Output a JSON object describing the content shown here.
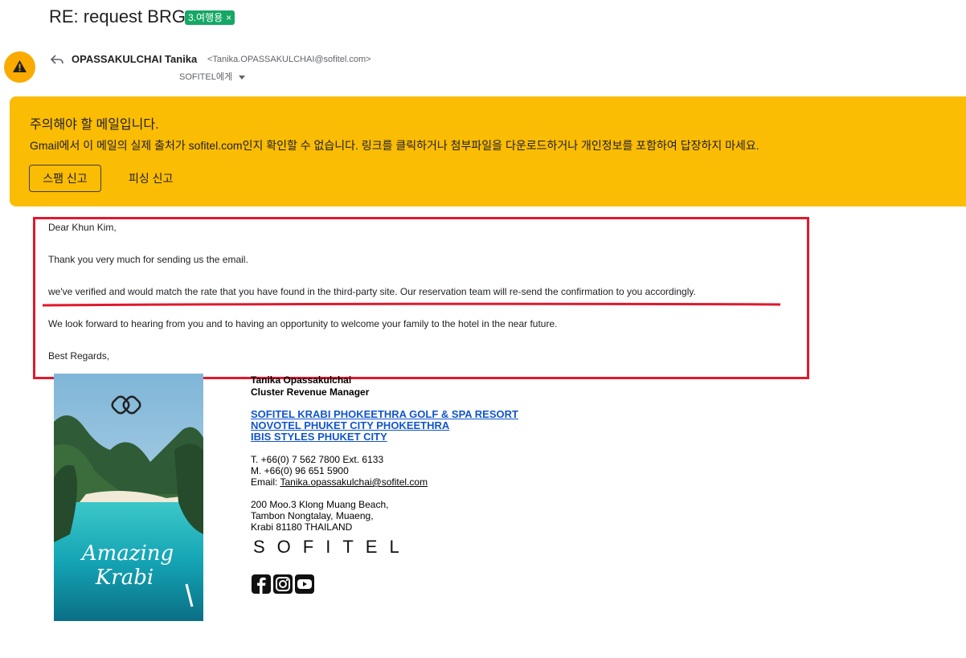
{
  "header": {
    "subject": "RE: request BRG",
    "label": "3.여행용",
    "label_close": "×"
  },
  "sender": {
    "name": "OPASSAKULCHAI Tanika",
    "email": "<Tanika.OPASSAKULCHAI@sofitel.com>",
    "to": "SOFITEL에게"
  },
  "warning": {
    "title": "주의해야 할 메일입니다.",
    "description": "Gmail에서 이 메일의 실제 출처가 sofitel.com인지 확인할 수 없습니다. 링크를 클릭하거나 첨부파일을 다운로드하거나 개인정보를 포함하여 답장하지 마세요.",
    "spam_button": "스팸 신고",
    "phishing_button": "피싱 신고"
  },
  "body": {
    "greeting": "Dear Khun Kim,",
    "line1": "Thank you very much for sending us the email.",
    "line2": "we've verified and would match the rate that you have found in the third-party site. Our reservation team will re-send the confirmation to you accordingly.",
    "line3": "We look forward to hearing from you and to having an opportunity to welcome your family to the hotel in the near future.",
    "closing": "Best Regards,"
  },
  "signature": {
    "name": "Tanika Opassakulchai",
    "title": "Cluster Revenue Manager",
    "hotels": [
      "SOFITEL KRABI PHOKEETHRA GOLF & SPA RESORT",
      "NOVOTEL PHUKET CITY PHOKEETHRA",
      "IBIS STYLES PHUKET CITY"
    ],
    "phone": "T. +66(0) 7 562 7800 Ext. 6133",
    "mobile": "M. +66(0) 96 651 5900",
    "email_label": "Email: ",
    "email": "Tanika.opassakulchai@sofitel.com",
    "address": [
      "200 Moo.3 Klong Muang Beach,",
      "Tambon Nongtalay, Muaeng,",
      "Krabi 81180 THAILAND"
    ],
    "brand": "SOFITEL",
    "photo_caption_1": "Amazing",
    "photo_caption_2": "Krabi"
  },
  "colors": {
    "warning_bg": "#fbbc04",
    "label_bg": "#16a765",
    "highlight": "#e0192e",
    "link": "#1155cc"
  },
  "icons": [
    "warning-icon",
    "reply-icon",
    "dropdown-caret-icon",
    "facebook-icon",
    "instagram-icon",
    "youtube-icon",
    "sofitel-emblem-icon"
  ]
}
